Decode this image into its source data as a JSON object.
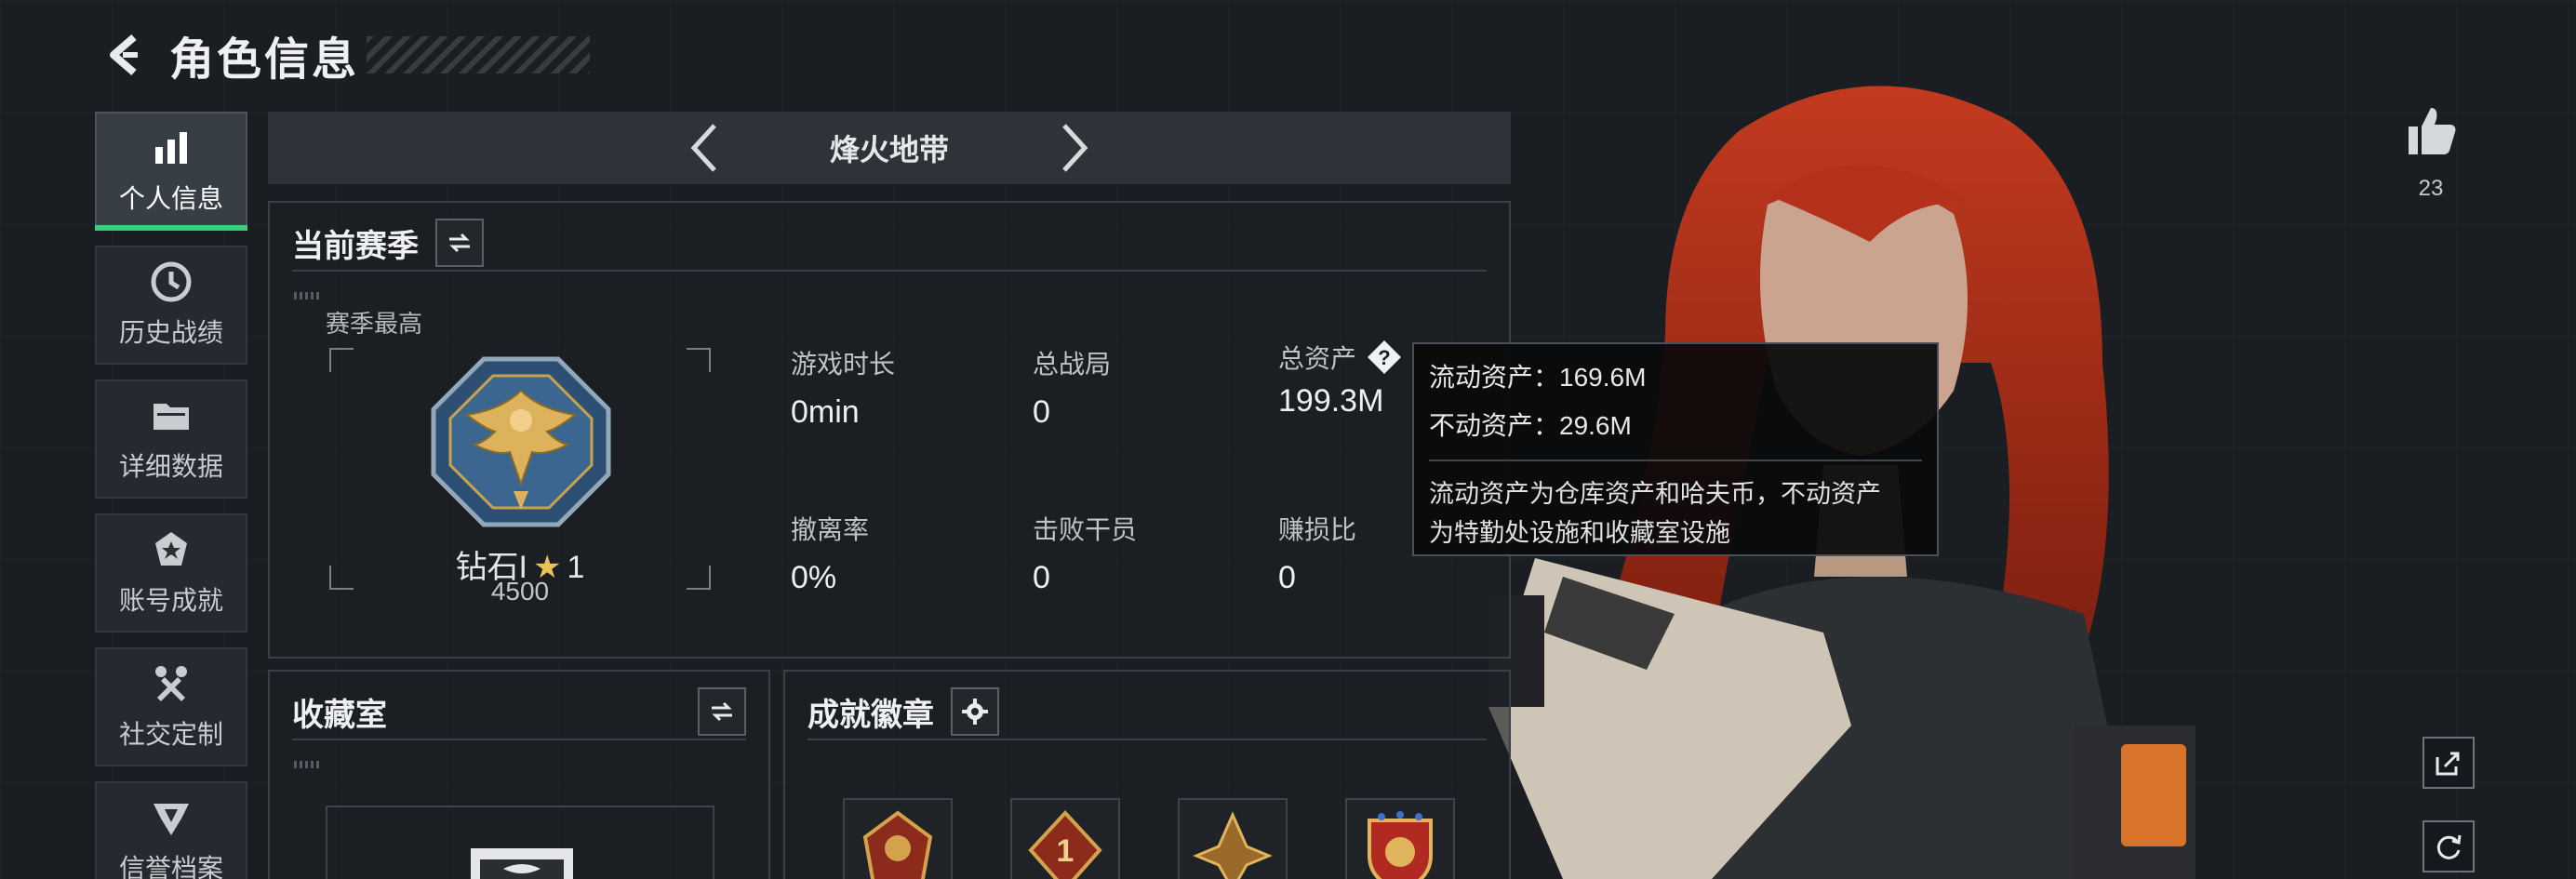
{
  "header": {
    "title": "角色信息"
  },
  "sidebar": {
    "items": [
      {
        "label": "个人信息",
        "active": true,
        "icon": "bar-chart-icon"
      },
      {
        "label": "历史战绩",
        "active": false,
        "icon": "clock-icon"
      },
      {
        "label": "详细数据",
        "active": false,
        "icon": "folder-icon"
      },
      {
        "label": "账号成就",
        "active": false,
        "icon": "medal-icon"
      },
      {
        "label": "社交定制",
        "active": false,
        "icon": "tools-icon"
      },
      {
        "label": "信誉档案",
        "active": false,
        "icon": "emblem-icon"
      }
    ]
  },
  "mode": {
    "title": "烽火地带"
  },
  "season": {
    "title": "当前赛季",
    "best_label": "赛季最高",
    "rank_name": "钻石I",
    "rank_star": "★",
    "rank_stars": "1",
    "rank_score": "4500"
  },
  "stats": {
    "play_time": {
      "label": "游戏时长",
      "value": "0min"
    },
    "total_matches": {
      "label": "总战局",
      "value": "0"
    },
    "total_assets": {
      "label": "总资产",
      "value": "199.3M"
    },
    "extract_rate": {
      "label": "撤离率",
      "value": "0%"
    },
    "kills": {
      "label": "击败干员",
      "value": "0"
    },
    "profit_ratio": {
      "label": "赚损比",
      "value": "0"
    }
  },
  "tooltip": {
    "liquid": "流动资产：169.6M",
    "fixed": "不动资产：29.6M",
    "desc_line1": "流动资产为仓库资产和哈夫币，不动资产",
    "desc_line2": "为特勤处设施和收藏室设施"
  },
  "collection": {
    "title": "收藏室"
  },
  "badges": {
    "title": "成就徽章",
    "first_badge_number": "1"
  },
  "like": {
    "count": "23"
  },
  "colors": {
    "accent_green": "#36d17a",
    "background": "#1a1e23",
    "hair": "#b4321c",
    "gold": "#e7c35a"
  }
}
